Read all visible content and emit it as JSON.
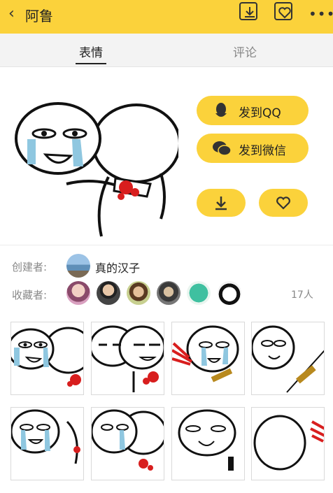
{
  "header": {
    "title": "阿鲁",
    "icons": [
      "chevron-left-icon",
      "download-icon",
      "favorite-icon",
      "more-icon"
    ],
    "more_glyph": "•••"
  },
  "tabs": [
    {
      "label": "表情",
      "active": true
    },
    {
      "label": "评论",
      "active": false
    }
  ],
  "actions": {
    "send_qq_label": "发到QQ",
    "send_wechat_label": "发到微信"
  },
  "info": {
    "creator_label": "创建者:",
    "creator_name": "真的汉子",
    "collector_label": "收藏者:",
    "collector_count": "17人",
    "collector_avatars": 6
  },
  "grid": {
    "rows": 2,
    "columns": 4,
    "count": 8
  },
  "colors": {
    "accent": "#fbd23b",
    "tear": "#8fc7e0",
    "blood": "#d81e1e",
    "sword": "#b8891e"
  }
}
